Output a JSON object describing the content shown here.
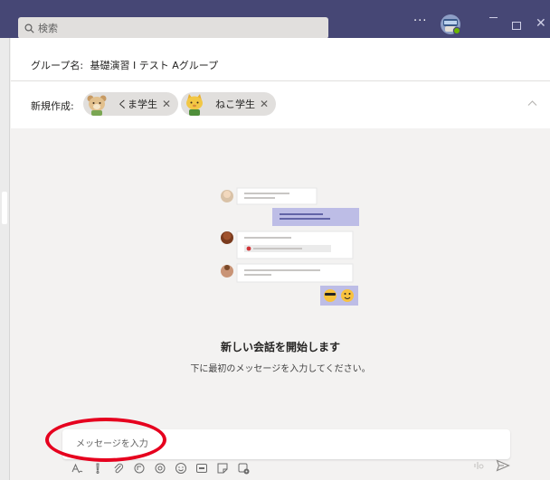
{
  "titlebar": {
    "search_placeholder": "検索",
    "more_label": "···"
  },
  "header": {
    "group_name_label": "グループ名:",
    "group_name_value": "基礎演習 I テスト Aグループ",
    "new_chat_label": "新規作成:",
    "recipients": [
      {
        "label": "くま学生",
        "remove": "✕"
      },
      {
        "label": "ねこ学生",
        "remove": "✕"
      }
    ]
  },
  "empty_state": {
    "title": "新しい会話を開始します",
    "subtitle": "下に最初のメッセージを入力してください。"
  },
  "compose": {
    "placeholder": "メッセージを入力"
  },
  "colors": {
    "titlebar": "#464775",
    "accent": "#6264a7",
    "highlight": "#e6001e",
    "panel": "#ffffff",
    "background": "#f3f2f1"
  },
  "icons": {
    "search": "search-icon",
    "user_avatar": "user-avatar-icon",
    "minimize": "minimize-icon",
    "maximize": "maximize-icon",
    "close": "close-icon",
    "collapse": "chevron-up-icon",
    "toolbar": [
      "format-icon",
      "priority-icon",
      "attach-icon",
      "loop-icon",
      "loop-component-icon",
      "emoji-icon",
      "gif-icon",
      "sticker-icon",
      "more-options-icon"
    ],
    "dictate": "dictate-icon",
    "send": "send-icon"
  }
}
